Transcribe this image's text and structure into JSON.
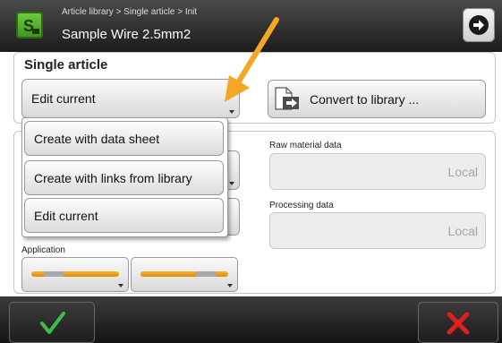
{
  "header": {
    "breadcrumb": "Article library > Single article > Init",
    "title": "Sample Wire 2.5mm2",
    "logo_icon": "s-logo-icon",
    "next_icon": "arrow-right-circle-icon"
  },
  "single_article": {
    "title": "Single article",
    "mode_selected": "Edit current",
    "convert_label": "Convert to library ..."
  },
  "dropdown": {
    "options": [
      "Create with data sheet",
      "Create with links from library",
      "Edit current"
    ]
  },
  "data": {
    "raw_material_label": "Raw material data",
    "raw_material_value": "Local",
    "processing_label": "Processing data",
    "processing_value": "Local"
  },
  "application": {
    "label": "Application"
  },
  "footer": {
    "ok_icon": "check-icon",
    "cancel_icon": "cross-icon"
  },
  "colors": {
    "accent_orange": "#f5a623",
    "ok_green": "#39b54a",
    "cancel_red": "#e02020"
  }
}
